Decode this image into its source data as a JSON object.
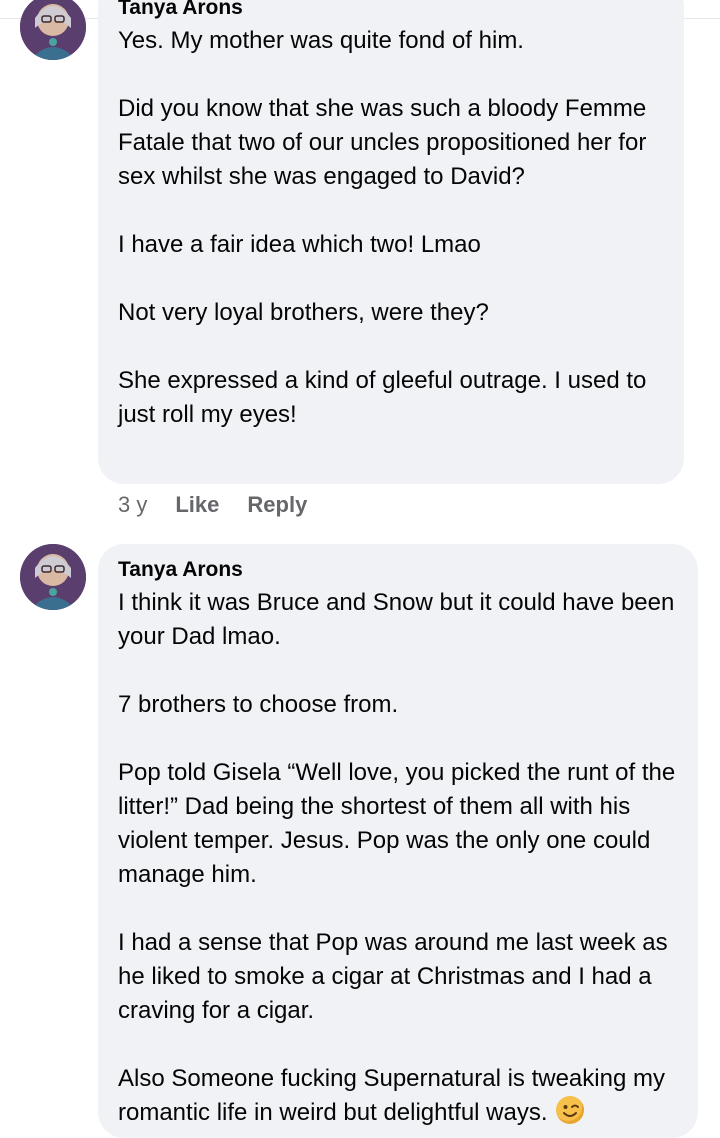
{
  "comments": [
    {
      "author": "Tanya Arons",
      "paragraphs": [
        "Yes.  My mother was quite fond of him.",
        "Did you know that she was such a bloody Femme Fatale that two of our uncles propositioned her for sex whilst she was engaged to David?",
        "I have a fair idea which two!  Lmao",
        "Not very loyal brothers, were they?",
        "She expressed a kind of gleeful outrage.  I used to just roll my eyes!"
      ],
      "time": "3 y",
      "like_label": "Like",
      "reply_label": "Reply"
    },
    {
      "author": "Tanya Arons",
      "paragraphs": [
        "I think it was Bruce and Snow but it could have been your Dad lmao.",
        "7 brothers to choose from.",
        "Pop told Gisela “Well love, you picked the runt of the litter!”  Dad being the shortest of them all with his violent temper.  Jesus. Pop was the only one could manage him.",
        "I had a sense that Pop was around me last week as he liked to smoke a cigar at Christmas and I had a craving for a cigar.",
        "Also Someone fucking Supernatural is  tweaking my romantic life in weird but delightful ways."
      ],
      "emoji": "winking-face"
    }
  ]
}
